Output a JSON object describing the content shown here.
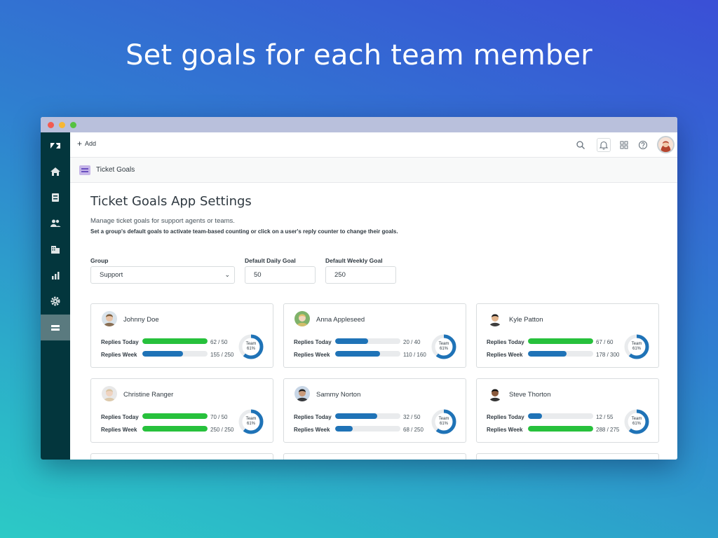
{
  "headline": "Set goals for each team member",
  "topbar": {
    "add_label": "Add"
  },
  "subbar": {
    "title": "Ticket Goals"
  },
  "settings": {
    "title": "Ticket Goals App Settings",
    "desc1": "Manage ticket goals for support agents or teams.",
    "desc2": "Set a group's default goals to activate team-based counting or click on a user's reply counter to change their goals.",
    "group_label": "Group",
    "group_value": "Support",
    "daily_label": "Default Daily Goal",
    "daily_value": "50",
    "weekly_label": "Default Weekly Goal",
    "weekly_value": "250"
  },
  "labels": {
    "today": "Replies Today",
    "week": "Replies Week",
    "team": "Team"
  },
  "colors": {
    "sidebar": "#03363d",
    "green": "#27c13c",
    "blue": "#1f73b7",
    "track": "#e9ebed"
  },
  "members": [
    {
      "name": "Johnny Doe",
      "today": "62 / 50",
      "today_pct": 1.0,
      "today_color": "green",
      "week": "155 / 250",
      "week_pct": 0.62,
      "week_color": "blue",
      "team_pct": "61%",
      "avatar": {
        "skin": "#e8c4a8",
        "hair": "#7a5a3a",
        "bg": "#d9e3ea"
      }
    },
    {
      "name": "Anna Appleseed",
      "today": "20 / 40",
      "today_pct": 0.5,
      "today_color": "blue",
      "week": "110 / 160",
      "week_pct": 0.69,
      "week_color": "blue",
      "team_pct": "61%",
      "avatar": {
        "skin": "#f3d6bd",
        "hair": "#e0c06a",
        "bg": "#7fb26a"
      }
    },
    {
      "name": "Kyle Patton",
      "today": "67 / 60",
      "today_pct": 1.0,
      "today_color": "green",
      "week": "178 / 300",
      "week_pct": 0.59,
      "week_color": "blue",
      "team_pct": "61%",
      "avatar": {
        "skin": "#e2b48c",
        "hair": "#1c1c1c",
        "bg": "#ffffff"
      }
    },
    {
      "name": "Christine Ranger",
      "today": "70 / 50",
      "today_pct": 1.0,
      "today_color": "green",
      "week": "250 / 250",
      "week_pct": 1.0,
      "week_color": "green",
      "team_pct": "61%",
      "avatar": {
        "skin": "#efd3c0",
        "hair": "#d9c3a0",
        "bg": "#e8e8e8"
      }
    },
    {
      "name": "Sammy Norton",
      "today": "32 / 50",
      "today_pct": 0.64,
      "today_color": "blue",
      "week": "68 / 250",
      "week_pct": 0.27,
      "week_color": "blue",
      "team_pct": "61%",
      "avatar": {
        "skin": "#c99a7a",
        "hair": "#1d1d1d",
        "bg": "#c8d6e6"
      }
    },
    {
      "name": "Steve Thorton",
      "today": "12 / 55",
      "today_pct": 0.22,
      "today_color": "blue",
      "week": "288 / 275",
      "week_pct": 1.0,
      "week_color": "green",
      "team_pct": "61%",
      "avatar": {
        "skin": "#8a5a3c",
        "hair": "#111111",
        "bg": "#ffffff"
      }
    }
  ]
}
